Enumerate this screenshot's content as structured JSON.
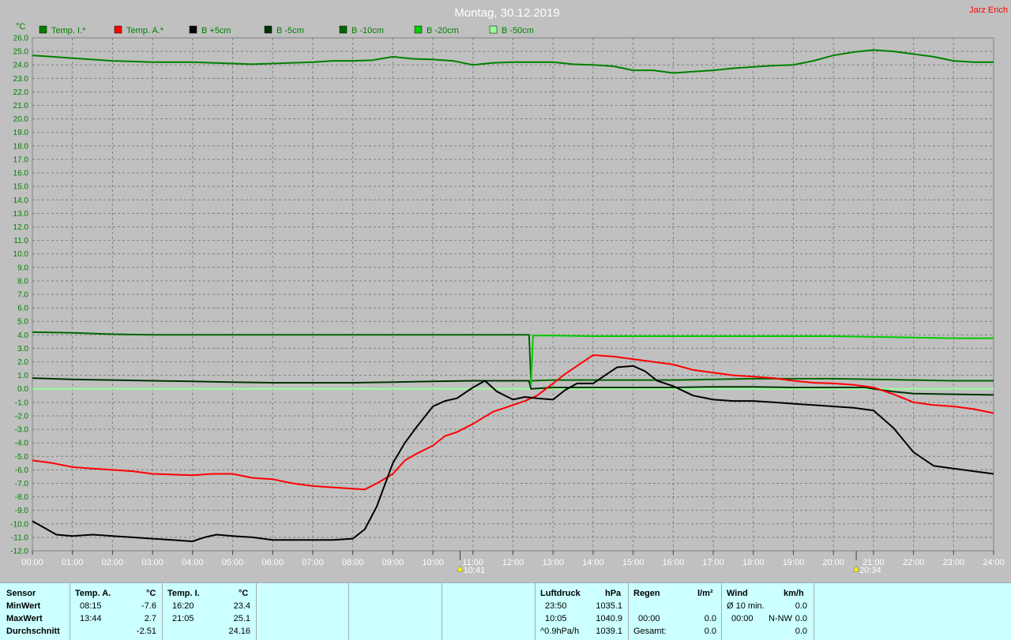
{
  "header": {
    "title": "Montag, 30.12.2019",
    "user": "Jarz Erich"
  },
  "colors": {
    "background": "#c0c0c0",
    "grid": "#808080",
    "tick_text": "#008000",
    "stats_bg": "#ccffff"
  },
  "legend": [
    {
      "label": "Temp. I.*",
      "color": "#008000"
    },
    {
      "label": "Temp. A.*",
      "color": "#ff0000"
    },
    {
      "label": "B +5cm",
      "color": "#000000"
    },
    {
      "label": "B -5cm",
      "color": "#003300"
    },
    {
      "label": "B -10cm",
      "color": "#006600"
    },
    {
      "label": "B -20cm",
      "color": "#00cc00"
    },
    {
      "label": "B -50cm",
      "color": "#99ff99"
    }
  ],
  "chart_data": {
    "type": "line",
    "title": "Montag, 30.12.2019",
    "ylabel": "°C",
    "xlabel": "",
    "ylim": [
      -12,
      26
    ],
    "xlim": [
      0,
      24
    ],
    "yticks": [
      "26.0",
      "25.0",
      "24.0",
      "23.0",
      "22.0",
      "21.0",
      "20.0",
      "19.0",
      "18.0",
      "17.0",
      "16.0",
      "15.0",
      "14.0",
      "13.0",
      "12.0",
      "11.0",
      "10.0",
      "9.0",
      "8.0",
      "7.0",
      "6.0",
      "5.0",
      "4.0",
      "3.0",
      "2.0",
      "1.0",
      "0.0",
      "-1.0",
      "-2.0",
      "-3.0",
      "-4.0",
      "-5.0",
      "-6.0",
      "-7.0",
      "-8.0",
      "-9.0",
      "-10.0",
      "-11.0",
      "-12.0"
    ],
    "xticks": [
      "00:00",
      "01:00",
      "02:00",
      "03:00",
      "04:00",
      "05:00",
      "06:00",
      "07:00",
      "08:00",
      "09:00",
      "10:00",
      "11:00",
      "12:00",
      "13:00",
      "14:00",
      "15:00",
      "16:00",
      "17:00",
      "18:00",
      "19:00",
      "20:00",
      "21:00",
      "22:00",
      "23:00",
      "24:00"
    ],
    "grid": true,
    "legend_position": "top",
    "markers": [
      {
        "label": "10:41",
        "x": 10.68,
        "type": "sunrise"
      },
      {
        "label": "20:34",
        "x": 20.57,
        "type": "sunset"
      }
    ],
    "series": [
      {
        "name": "Temp. I.*",
        "color": "#008000",
        "x": [
          0,
          0.5,
          1,
          1.5,
          2,
          2.5,
          3,
          3.5,
          4,
          4.5,
          5,
          5.5,
          6,
          6.5,
          7,
          7.5,
          8,
          8.5,
          9,
          9.5,
          10,
          10.5,
          11,
          11.5,
          12,
          12.5,
          13,
          13.5,
          14,
          14.5,
          15,
          15.5,
          16,
          16.5,
          17,
          17.5,
          18,
          18.5,
          19,
          19.5,
          20,
          20.5,
          21,
          21.5,
          22,
          22.5,
          23,
          23.5,
          24
        ],
        "y": [
          24.7,
          24.6,
          24.5,
          24.4,
          24.3,
          24.25,
          24.2,
          24.2,
          24.2,
          24.15,
          24.1,
          24.05,
          24.1,
          24.15,
          24.2,
          24.3,
          24.3,
          24.35,
          24.6,
          24.45,
          24.4,
          24.3,
          24.0,
          24.15,
          24.2,
          24.2,
          24.2,
          24.05,
          24.0,
          23.9,
          23.6,
          23.6,
          23.4,
          23.5,
          23.6,
          23.75,
          23.85,
          23.95,
          24.0,
          24.3,
          24.7,
          24.95,
          25.1,
          25.0,
          24.8,
          24.6,
          24.3,
          24.2,
          24.2
        ]
      },
      {
        "name": "Temp. A.*",
        "color": "#ff0000",
        "x": [
          0,
          0.5,
          1,
          1.5,
          2,
          2.5,
          3,
          3.5,
          4,
          4.5,
          5,
          5.5,
          6,
          6.5,
          7,
          7.5,
          8,
          8.3,
          8.6,
          9,
          9.3,
          9.6,
          10,
          10.3,
          10.6,
          11,
          11.5,
          12,
          12.3,
          12.6,
          13,
          13.3,
          13.6,
          14,
          14.5,
          15,
          15.5,
          16,
          16.5,
          17,
          17.5,
          18,
          18.5,
          19,
          19.5,
          20,
          20.5,
          21,
          21.5,
          22,
          22.5,
          23,
          23.5,
          24
        ],
        "y": [
          -5.3,
          -5.5,
          -5.8,
          -5.9,
          -6.0,
          -6.1,
          -6.3,
          -6.35,
          -6.4,
          -6.3,
          -6.3,
          -6.6,
          -6.7,
          -7.0,
          -7.2,
          -7.3,
          -7.4,
          -7.45,
          -7.0,
          -6.3,
          -5.3,
          -4.8,
          -4.2,
          -3.5,
          -3.2,
          -2.6,
          -1.7,
          -1.2,
          -0.9,
          -0.5,
          0.4,
          1.1,
          1.7,
          2.5,
          2.4,
          2.2,
          2.0,
          1.8,
          1.4,
          1.2,
          1.0,
          0.9,
          0.8,
          0.6,
          0.45,
          0.4,
          0.3,
          0.1,
          -0.4,
          -1.0,
          -1.2,
          -1.3,
          -1.5,
          -1.8
        ]
      },
      {
        "name": "B +5cm",
        "color": "#000000",
        "x": [
          0,
          0.3,
          0.6,
          1,
          1.5,
          2,
          2.5,
          3,
          3.5,
          4,
          4.3,
          4.6,
          5,
          5.5,
          6,
          6.5,
          7,
          7.5,
          8,
          8.3,
          8.6,
          9,
          9.3,
          9.6,
          10,
          10.3,
          10.6,
          11,
          11.3,
          11.6,
          12,
          12.3,
          12.6,
          13,
          13.3,
          13.6,
          14,
          14.3,
          14.6,
          15,
          15.3,
          15.6,
          16,
          16.5,
          17,
          17.5,
          18,
          18.5,
          19,
          19.5,
          20,
          20.5,
          21,
          21.5,
          22,
          22.5,
          23,
          23.5,
          24
        ],
        "y": [
          -9.8,
          -10.3,
          -10.8,
          -10.9,
          -10.8,
          -10.9,
          -11.0,
          -11.1,
          -11.2,
          -11.3,
          -11.0,
          -10.8,
          -10.9,
          -11.0,
          -11.2,
          -11.2,
          -11.2,
          -11.2,
          -11.1,
          -10.4,
          -8.7,
          -5.5,
          -4.0,
          -2.8,
          -1.3,
          -0.9,
          -0.7,
          0.1,
          0.6,
          -0.2,
          -0.8,
          -0.6,
          -0.7,
          -0.8,
          -0.1,
          0.4,
          0.4,
          1.0,
          1.6,
          1.7,
          1.3,
          0.6,
          0.2,
          -0.5,
          -0.8,
          -0.9,
          -0.9,
          -1.0,
          -1.1,
          -1.2,
          -1.3,
          -1.4,
          -1.6,
          -2.9,
          -4.7,
          -5.7,
          -5.9,
          -6.1,
          -6.3
        ]
      },
      {
        "name": "B -5cm",
        "color": "#003300",
        "x": [
          0,
          1,
          2,
          3,
          4,
          5,
          6,
          7,
          8,
          9,
          10,
          11,
          12,
          12.4,
          12.45,
          13,
          14,
          15,
          16,
          17,
          18,
          19,
          20,
          20.8,
          21,
          21.5,
          22,
          23,
          24
        ],
        "y": [
          0.8,
          0.7,
          0.65,
          0.6,
          0.55,
          0.5,
          0.45,
          0.45,
          0.45,
          0.5,
          0.55,
          0.6,
          0.6,
          0.6,
          0.0,
          0.1,
          0.1,
          0.1,
          0.1,
          0.15,
          0.15,
          0.1,
          0.1,
          0.1,
          0.0,
          -0.2,
          -0.35,
          -0.4,
          -0.45
        ]
      },
      {
        "name": "B -10cm",
        "color": "#006600",
        "x": [
          0,
          1,
          2,
          3,
          4,
          5,
          6,
          7,
          8,
          9,
          10,
          11,
          12,
          12.4,
          12.45,
          13,
          14,
          15,
          16,
          17,
          18,
          19,
          20,
          21,
          22,
          23,
          24
        ],
        "y": [
          4.2,
          4.15,
          4.05,
          4.0,
          4.0,
          4.0,
          4.0,
          4.0,
          4.0,
          4.0,
          4.0,
          4.0,
          4.0,
          4.0,
          0.6,
          0.65,
          0.65,
          0.65,
          0.65,
          0.7,
          0.75,
          0.75,
          0.75,
          0.7,
          0.65,
          0.6,
          0.6
        ]
      },
      {
        "name": "B -20cm",
        "color": "#00cc00",
        "x": [
          12.45,
          12.5,
          13,
          14,
          15,
          16,
          17,
          18,
          19,
          20,
          21,
          22,
          23,
          24
        ],
        "y": [
          0.3,
          3.95,
          3.95,
          3.9,
          3.9,
          3.9,
          3.9,
          3.9,
          3.9,
          3.9,
          3.85,
          3.8,
          3.75,
          3.75
        ]
      },
      {
        "name": "B -50cm",
        "color": "#99ff99",
        "x": [
          0,
          2,
          4,
          6,
          8,
          10,
          12,
          14,
          16,
          18,
          20,
          22,
          24
        ],
        "y": [
          0.0,
          0.0,
          0.0,
          0.0,
          0.0,
          0.0,
          0.0,
          0.0,
          0.0,
          0.0,
          0.0,
          0.0,
          0.0
        ]
      }
    ]
  },
  "stats": {
    "col1": {
      "sensor": "Sensor",
      "min": "MinWert",
      "max": "MaxWert",
      "avg": "Durchschnitt"
    },
    "temp_a": {
      "header": "Temp. A.",
      "unit": "°C",
      "min_time": "08:15",
      "min_val": "-7.6",
      "max_time": "13:44",
      "max_val": "2.7",
      "avg": "-2.51"
    },
    "temp_i": {
      "header": "Temp. I.",
      "unit": "°C",
      "min_time": "16:20",
      "min_val": "23.4",
      "max_time": "21:05",
      "max_val": "25.1",
      "avg": "24.16"
    },
    "pressure": {
      "header": "Luftdruck",
      "unit": "hPa",
      "r1_time": "23:50",
      "r1_val": "1035.1",
      "r2_time": "10:05",
      "r2_val": "1040.9",
      "r3_label": "^0.9hPa/h",
      "r3_val": "1039.1"
    },
    "rain": {
      "header": "Regen",
      "unit": "l/m²",
      "r2_time": "00:00",
      "r2_val": "0.0",
      "r3_label": "Gesamt:",
      "r3_val": "0.0"
    },
    "wind": {
      "header": "Wind",
      "unit": "km/h",
      "r1_label": "Ø 10 min.",
      "r1_val": "0.0",
      "r2_time": "00:00",
      "r2_dir": "N-NW",
      "r2_val": "0.0",
      "r3_val": "0.0"
    }
  }
}
